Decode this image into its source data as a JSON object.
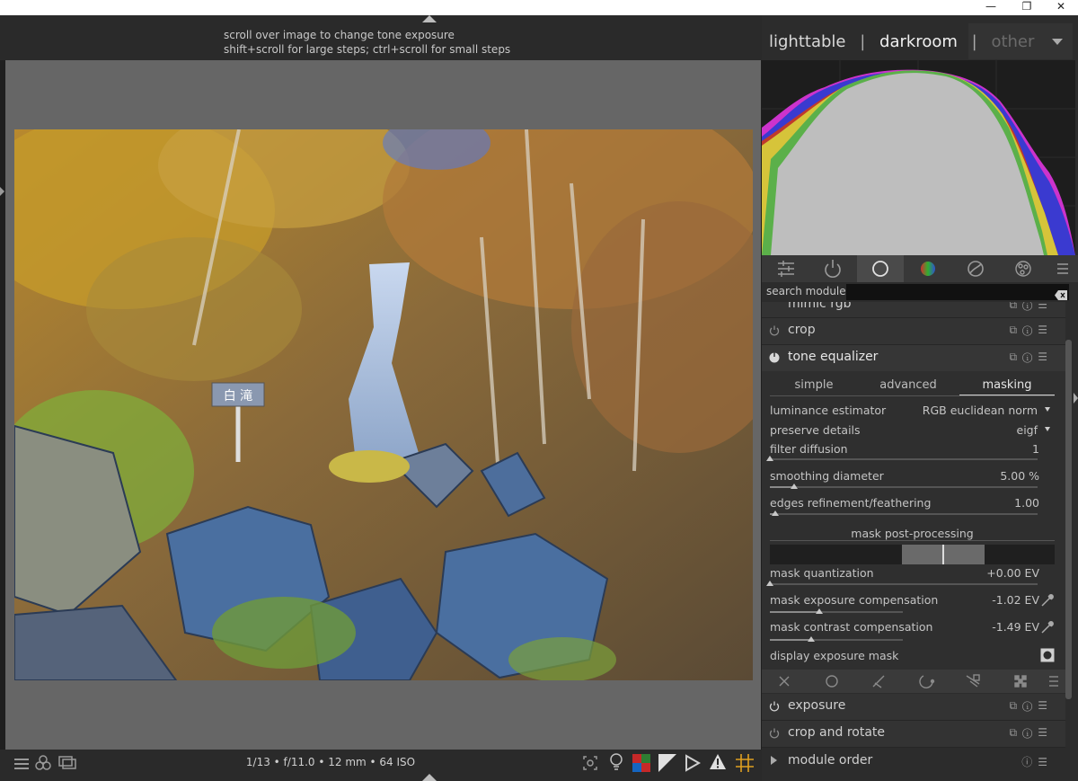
{
  "window": {
    "buttons": [
      "—",
      "❐",
      "✕"
    ]
  },
  "hint": {
    "line1": "scroll over image to change tone exposure",
    "line2": "shift+scroll for large steps; ctrl+scroll for small steps"
  },
  "views": {
    "lighttable": "lighttable",
    "darkroom": "darkroom",
    "other": "other",
    "separator": "|"
  },
  "search": {
    "label": "search module"
  },
  "modules": {
    "mimic_rgb": "mimic rgb",
    "crop": "crop",
    "tone_equalizer": "tone equalizer",
    "exposure": "exposure",
    "crop_and_rotate": "crop and rotate",
    "module_order": "module order"
  },
  "tone_equalizer": {
    "tabs": [
      "simple",
      "advanced",
      "masking"
    ],
    "active_tab": "masking",
    "luminance_estimator": {
      "label": "luminance estimator",
      "value": "RGB euclidean norm"
    },
    "preserve_details": {
      "label": "preserve details",
      "value": "eigf"
    },
    "filter_diffusion": {
      "label": "filter diffusion",
      "value": "1",
      "level": 0.0
    },
    "smoothing_diameter": {
      "label": "smoothing diameter",
      "value": "5.00 %",
      "level": 0.09
    },
    "edges_refinement": {
      "label": "edges refinement/feathering",
      "value": "1.00",
      "level": 0.02
    },
    "mask_post_processing": "mask post-processing",
    "mask_quantization": {
      "label": "mask quantization",
      "value": "+0.00 EV",
      "level": 0.0
    },
    "mask_exposure_comp": {
      "label": "mask exposure compensation",
      "value": "-1.02 EV",
      "level": 0.37
    },
    "mask_contrast_comp": {
      "label": "mask contrast compensation",
      "value": "-1.49 EV",
      "level": 0.31
    },
    "display_exposure_mask": {
      "label": "display exposure mask"
    }
  },
  "exif": "1/13 • f/11.0 • 12 mm • 64 ISO",
  "photo": {
    "sign_text": "白 滝"
  },
  "colors": {
    "panel": "#2c2c2c",
    "center_bg": "#666666",
    "histogram_gray": "#bebebe",
    "histogram_red": "#c0392b",
    "histogram_blue": "#3a3ad0",
    "histogram_magenta": "#cc33cc"
  }
}
